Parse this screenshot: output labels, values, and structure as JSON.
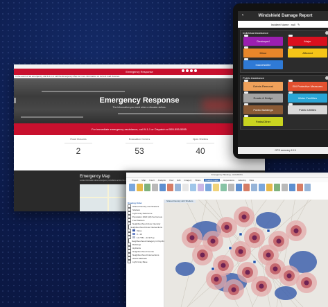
{
  "browser": {
    "site_title": "Emergency Response",
    "notice": "In the event of an emergency, dial 9-1-1 or call the Emergency Map for more information on current road closures.",
    "hero_title": "Emergency Response",
    "hero_subtitle": "The information you need when a disaster strikes.",
    "red_banner": "For immediate emergency assistance, call 9-1-1 or Dispatch at 555-555-5555.",
    "stats": [
      {
        "label": "Road Closures",
        "value": "2"
      },
      {
        "label": "Evacuation Centers",
        "value": "53"
      },
      {
        "label": "Open Shelters",
        "value": "40"
      }
    ],
    "map_title": "Emergency Map",
    "map_subtitle": "Locate information about emergency conditions across the county."
  },
  "pro": {
    "window_title": "Emergency Planning - ArcGIS Pro",
    "tabs": [
      "Project",
      "Map",
      "Insert",
      "Analysis",
      "View",
      "Edit",
      "Imagery",
      "Share",
      "Feature Layer",
      "Appearance",
      "Labeling",
      "Data"
    ],
    "active_tab_index": 8,
    "map_tab": "Shared Density with Shelters",
    "contents": [
      {
        "text": "Drawing Order",
        "header": true
      },
      {
        "text": "Shared Density and Shelters"
      },
      {
        "text": "Shelters"
      },
      {
        "text": "Light Gray Reference"
      },
      {
        "text": "Population 2020 (All) Sa Census"
      },
      {
        "text": "Fuel Stations"
      },
      {
        "text": "Neighbourhood Zone Intensity"
      },
      {
        "text": "Neighbourhood Zone Intersections"
      },
      {
        "text": "Value"
      },
      {
        "text": "0 - 10"
      },
      {
        "text": "12.7781 - 24.9 Pop"
      },
      {
        "text": "Neighbourhood Category in Pop/Km2"
      },
      {
        "text": "Buildings"
      },
      {
        "text": "Hydrants"
      },
      {
        "text": "Neighbourhood Counts"
      },
      {
        "text": "Neighbourhood Intersections"
      },
      {
        "text": "World Hillshade"
      },
      {
        "text": "Light Gray Base"
      }
    ],
    "legend_colors": [
      "#3b5aa8",
      "#6f89c9",
      "#b0b8c8",
      "#e0b2b0",
      "#c7635f",
      "#8c2b56"
    ]
  },
  "tablet": {
    "title": "Windshield Damage Report",
    "incident_label": "Incident Name : null",
    "sections": [
      {
        "name": "Individual Assistance",
        "buttons": [
          {
            "label": "Destroyed",
            "color": "#9b1fb0",
            "text_color": "#ffffff"
          },
          {
            "label": "Major",
            "color": "#d9101e",
            "text_color": "#ffffff"
          },
          {
            "label": "Minor",
            "color": "#e8862a",
            "text_color": "#111111"
          },
          {
            "label": "Affected",
            "color": "#f5c518",
            "text_color": "#111111"
          },
          {
            "label": "Inaccessible",
            "color": "#2f7ad6",
            "text_color": "#ffffff"
          }
        ]
      },
      {
        "name": "Public Assistance",
        "buttons": [
          {
            "label": "Debris Removal",
            "color": "#f0a15a",
            "text_color": "#111111"
          },
          {
            "label": "EM Protective Measures",
            "color": "#e2502f",
            "text_color": "#ffffff"
          },
          {
            "label": "Roads & Bridge",
            "color": "#a3a3a3",
            "text_color": "#111111"
          },
          {
            "label": "Water Facilities",
            "color": "#2aa6d6",
            "text_color": "#ffffff"
          },
          {
            "label": "Public Buildings",
            "color": "#8a5a35",
            "text_color": "#ffffff"
          },
          {
            "label": "Public Utilities",
            "color": "#d8d8d8",
            "text_color": "#111111"
          },
          {
            "label": "Parks/Other",
            "color": "#c9d420",
            "text_color": "#111111"
          }
        ]
      }
    ],
    "gps_label": "GPS accuracy 13 ft"
  }
}
